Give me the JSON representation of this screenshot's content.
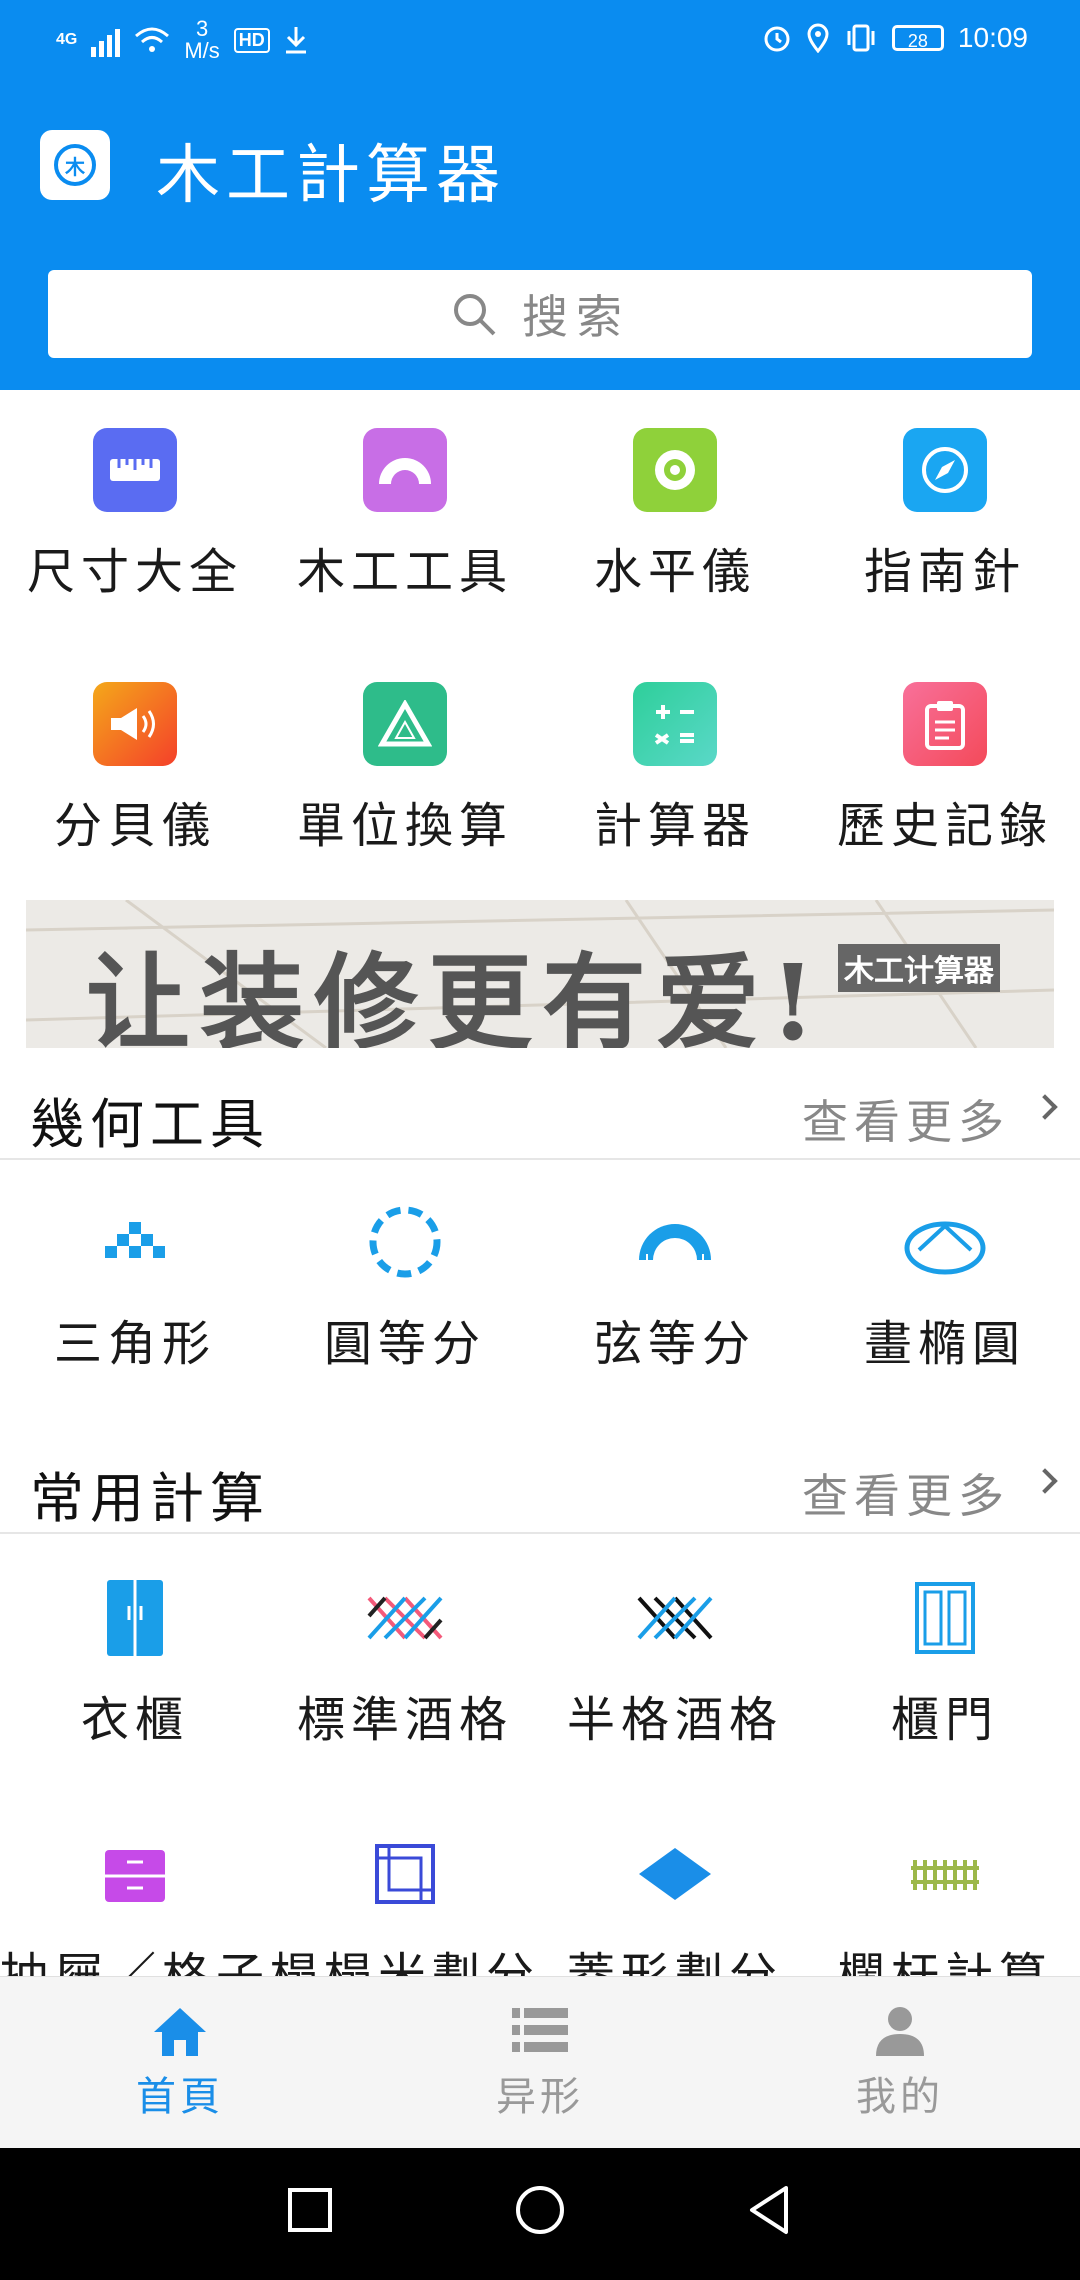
{
  "status_bar": {
    "network": "4G",
    "speed_value": "3",
    "speed_unit": "M/s",
    "hd": "HD",
    "battery": "28",
    "time": "10:09",
    "icons": [
      "signal-icon",
      "wifi-icon",
      "download-icon",
      "alarm-icon",
      "location-icon",
      "vibrate-icon",
      "battery-icon"
    ]
  },
  "header": {
    "title": "木工計算器",
    "logo_char": "木",
    "search_placeholder": "搜索",
    "bg_color": "#0a8cf0"
  },
  "tools": [
    {
      "label": "尺寸大全",
      "icon": "ruler-icon",
      "color": "#5a6cf2"
    },
    {
      "label": "木工工具",
      "icon": "protractor-icon",
      "color": "#c86ee6"
    },
    {
      "label": "水平儀",
      "icon": "level-icon",
      "color": "#8fd13a"
    },
    {
      "label": "指南針",
      "icon": "compass-icon",
      "color": "#1aa6f2"
    },
    {
      "label": "分貝儀",
      "icon": "megaphone-icon",
      "color": "#f47a2a"
    },
    {
      "label": "單位換算",
      "icon": "recycle-triangle-icon",
      "color": "#2ebc8a"
    },
    {
      "label": "計算器",
      "icon": "calculator-icon",
      "color": "#34d3a8"
    },
    {
      "label": "歷史記錄",
      "icon": "clipboard-icon",
      "color": "#f45a7a"
    }
  ],
  "banner": {
    "slogan": "让装修更有爱!",
    "tag": "木工计算器"
  },
  "geometry": {
    "title": "幾何工具",
    "more": "查看更多",
    "items": [
      {
        "label": "三角形",
        "icon": "triangle-dots-icon"
      },
      {
        "label": "圓等分",
        "icon": "dashed-circle-icon"
      },
      {
        "label": "弦等分",
        "icon": "semicircle-ruler-icon"
      },
      {
        "label": "畫橢圓",
        "icon": "ellipse-icon"
      }
    ]
  },
  "common": {
    "title": "常用計算",
    "more": "查看更多",
    "items": [
      {
        "label": "衣櫃",
        "icon": "wardrobe-icon"
      },
      {
        "label": "標準酒格",
        "icon": "wine-rack-icon"
      },
      {
        "label": "半格酒格",
        "icon": "half-wine-rack-icon"
      },
      {
        "label": "櫃門",
        "icon": "cabinet-door-icon"
      },
      {
        "label": "抽屜／格子",
        "icon": "drawer-icon"
      },
      {
        "label": "榻榻米劃分",
        "icon": "tatami-icon"
      },
      {
        "label": "菱形劃分",
        "icon": "diamond-icon"
      },
      {
        "label": "欄杆計算",
        "icon": "fence-icon"
      }
    ]
  },
  "tabbar": {
    "tabs": [
      {
        "label": "首頁",
        "icon": "home-icon",
        "active": true
      },
      {
        "label": "异形",
        "icon": "list-icon",
        "active": false
      },
      {
        "label": "我的",
        "icon": "person-icon",
        "active": false
      }
    ],
    "active_color": "#1a8ee8",
    "inactive_color": "#999999"
  },
  "navbar": {
    "buttons": [
      "recent-apps-button",
      "home-button",
      "back-button"
    ]
  }
}
